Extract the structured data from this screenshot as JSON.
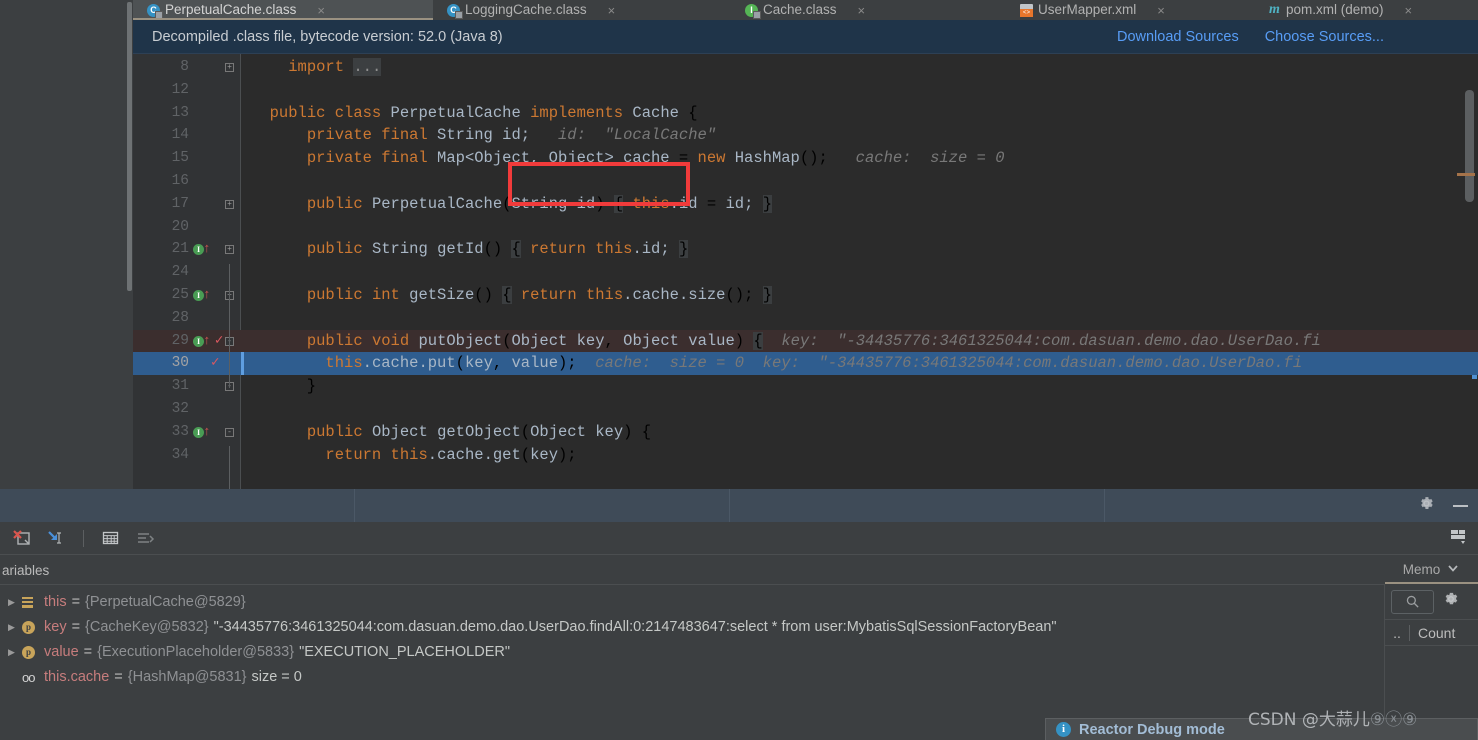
{
  "tabs": [
    {
      "label": "PerpetualCache.class",
      "icon": "java-class-icon",
      "icon_letter": "C",
      "active": true,
      "close": "×"
    },
    {
      "label": "LoggingCache.class",
      "icon": "java-class-icon",
      "icon_letter": "C",
      "active": false,
      "close": "×"
    },
    {
      "label": "Cache.class",
      "icon": "java-interface-icon",
      "icon_letter": "I",
      "active": false,
      "close": "×"
    },
    {
      "label": "UserMapper.xml",
      "icon": "xml-mapper-icon",
      "icon_letter": "",
      "active": false,
      "close": "×"
    },
    {
      "label": "pom.xml (demo)",
      "icon": "maven-icon",
      "icon_letter": "m",
      "active": false,
      "close": "×"
    }
  ],
  "notification": {
    "message": "Decompiled .class file, bytecode version: 52.0 (Java 8)",
    "download_sources": "Download Sources",
    "choose_sources": "Choose Sources..."
  },
  "editor": {
    "lines": [
      {
        "num": "8",
        "gicons": "",
        "fold": "+",
        "text_html": "    <span class=\"kw\">import</span> <span class=\"fold-dots\">...</span>"
      },
      {
        "num": "12",
        "gicons": "",
        "fold": "",
        "text_html": ""
      },
      {
        "num": "13",
        "gicons": "",
        "fold": "",
        "text_html": "  <span class=\"kw\">public class</span> <span class=\"cls\">PerpetualCache</span> <span class=\"kw\">implements</span> <span class=\"cls\">Cache</span> {"
      },
      {
        "num": "14",
        "gicons": "",
        "fold": "",
        "text_html": "      <span class=\"kw\">private final</span> <span class=\"cls\">String</span> <span class=\"id\">id;</span>   <span class=\"hint\">id:  \"LocalCache\"</span>"
      },
      {
        "num": "15",
        "gicons": "",
        "fold": "",
        "text_html": "      <span class=\"kw\">private final</span> <span class=\"cls\">Map&lt;Object, Object&gt;</span> <span class=\"id\">cache</span> = <span class=\"kw\">new</span> <span class=\"cls\">HashMap</span>();   <span class=\"hint\">cache:  size = 0</span>"
      },
      {
        "num": "16",
        "gicons": "",
        "fold": "",
        "text_html": ""
      },
      {
        "num": "17",
        "gicons": "",
        "fold": "+",
        "text_html": "      <span class=\"kw\">public</span> <span class=\"cls\">PerpetualCache</span>(<span class=\"cls\">String</span> <span class=\"id\">id</span>) <span class=\"brace-hl\">{</span> <span class=\"kw\">this</span><span class=\"id\">.id</span> = <span class=\"id\">id;</span> <span class=\"brace-hl\">}</span>"
      },
      {
        "num": "20",
        "gicons": "",
        "fold": "",
        "text_html": ""
      },
      {
        "num": "21",
        "gicons": "impl",
        "fold": "+",
        "text_html": "      <span class=\"kw\">public</span> <span class=\"cls\">String</span> <span class=\"id\">getId</span>() <span class=\"brace-hl\">{</span> <span class=\"kw\">return</span> <span class=\"kw\">this</span><span class=\"id\">.id;</span> <span class=\"brace-hl\">}</span>"
      },
      {
        "num": "24",
        "gicons": "",
        "fold": "",
        "text_html": ""
      },
      {
        "num": "25",
        "gicons": "impl",
        "fold": "+",
        "text_html": "      <span class=\"kw\">public</span> <span class=\"kw\">int</span> <span class=\"id\">getSize</span>() <span class=\"brace-hl\">{</span> <span class=\"kw\">return</span> <span class=\"kw\">this</span><span class=\"id\">.cache.size</span>(); <span class=\"brace-hl\">}</span>"
      },
      {
        "num": "28",
        "gicons": "",
        "fold": "",
        "text_html": ""
      },
      {
        "num": "29",
        "gicons": "implbp",
        "fold": "-",
        "row": "exec",
        "text_html": "      <span class=\"kw\">public</span> <span class=\"kw\">void</span> <span class=\"id\">putObject</span>(<span class=\"cls\">Object</span> <span class=\"id\">key</span>, <span class=\"cls\">Object</span> <span class=\"id\">value</span>) <span class=\"brace-hl\">{</span>  <span class=\"hint\">key:  \"-34435776:3461325044:com.dasuan.demo.dao.UserDao.fi</span>"
      },
      {
        "num": "30",
        "gicons": "bp",
        "fold": "",
        "row": "cur",
        "text_html": "        <span class=\"kw\">this</span><span class=\"id\">.cache.put</span>(<span class=\"id\">key</span>, <span class=\"id\">value</span>);  <span class=\"hint\">cache:  size = 0</span>  <span class=\"hint\">key:  \"-34435776:3461325044:com.dasuan.demo.dao.UserDao.fi</span>"
      },
      {
        "num": "31",
        "gicons": "",
        "fold": "-",
        "text_html": "      }"
      },
      {
        "num": "32",
        "gicons": "",
        "fold": "",
        "text_html": ""
      },
      {
        "num": "33",
        "gicons": "impl",
        "fold": "-",
        "text_html": "      <span class=\"kw\">public</span> <span class=\"cls\">Object</span> <span class=\"id\">getObject</span>(<span class=\"cls\">Object</span> <span class=\"id\">key</span>) {"
      },
      {
        "num": "34",
        "gicons": "",
        "fold": "",
        "text_html": "        <span class=\"kw\">return</span> <span class=\"kw\">this</span><span class=\"id\">.cache.get</span>(<span class=\"id\">key</span>);"
      }
    ],
    "highlight_word": "PerpetualCache",
    "highlight_color": "#f13b3b"
  },
  "debug_toolbar": {
    "icons": [
      {
        "name": "mute-breakpoints-icon"
      },
      {
        "name": "step-into-icon"
      },
      {
        "name": "show-types-icon"
      },
      {
        "name": "sort-values-icon"
      }
    ],
    "settings_icon": "gear-icon",
    "minimize_icon": "minimize-icon",
    "layout_icon": "layout-settings-icon"
  },
  "variables": {
    "title": "ariables",
    "rows": [
      {
        "expandable": true,
        "icon": "this-icon",
        "icon_letter": "",
        "name": "this",
        "eq": "=",
        "type": "{PerpetualCache@5829}",
        "value": ""
      },
      {
        "expandable": true,
        "icon": "parameter-icon",
        "icon_letter": "p",
        "name": "key",
        "eq": "=",
        "type": "{CacheKey@5832}",
        "value": "\"-34435776:3461325044:com.dasuan.demo.dao.UserDao.findAll:0:2147483647:select * from user:MybatisSqlSessionFactoryBean\""
      },
      {
        "expandable": true,
        "icon": "parameter-icon",
        "icon_letter": "p",
        "name": "value",
        "eq": "=",
        "type": "{ExecutionPlaceholder@5833}",
        "value": "\"EXECUTION_PLACEHOLDER\""
      },
      {
        "expandable": false,
        "icon": "field-icon",
        "icon_letter": "oo",
        "name": "this.cache",
        "eq": "=",
        "type": "{HashMap@5831}",
        "value": "size = 0"
      }
    ]
  },
  "memory_pane": {
    "tab_label": "Memo",
    "chevron": "⌄",
    "search_icon": "search-icon",
    "gear_icon": "gear-icon",
    "col_dots": "..",
    "col_count": "Count"
  },
  "reactor_popup": {
    "icon": "info-icon",
    "icon_letter": "i",
    "text": "Reactor Debug mode"
  },
  "watermark": {
    "text": "CSDN @大蒜儿",
    "suffix": "⑨ⓧ⑨"
  }
}
